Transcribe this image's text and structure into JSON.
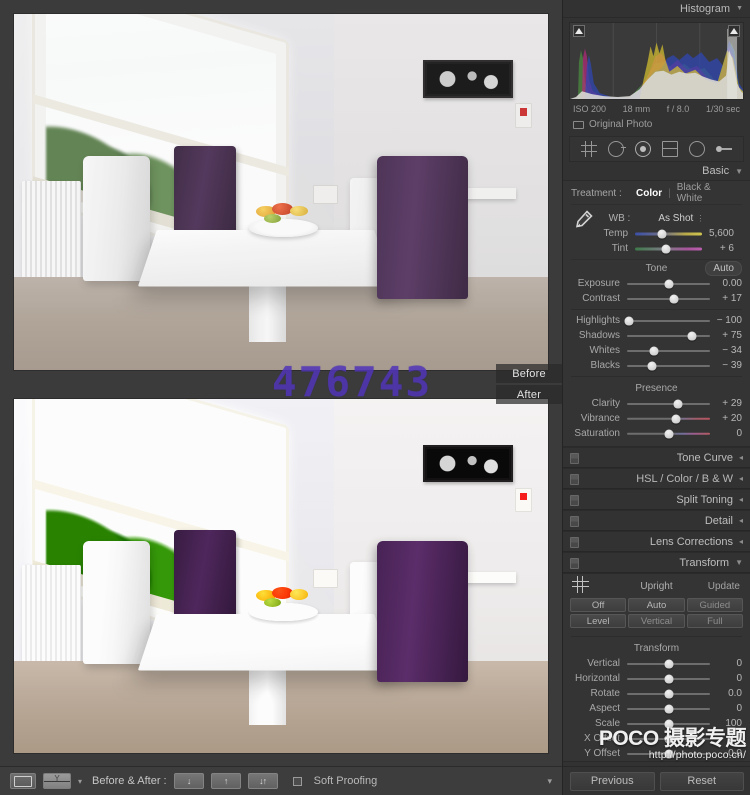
{
  "histogram": {
    "title": "Histogram",
    "iso": "ISO 200",
    "focal": "18 mm",
    "aperture": "f / 8.0",
    "shutter": "1/30 sec",
    "original_photo_label": "Original Photo",
    "clip_shadow_icon": "shadow-clipping-icon",
    "clip_highlight_icon": "highlight-clipping-icon"
  },
  "tools": [
    {
      "name": "crop-overlay-tool",
      "icon": "crop-icon"
    },
    {
      "name": "spot-removal-tool",
      "icon": "spot-removal-icon"
    },
    {
      "name": "red-eye-correction-tool",
      "icon": "red-eye-icon"
    },
    {
      "name": "graduated-filter-tool",
      "icon": "graduated-filter-icon"
    },
    {
      "name": "radial-filter-tool",
      "icon": "radial-filter-icon"
    },
    {
      "name": "adjustment-brush-tool",
      "icon": "brush-icon"
    }
  ],
  "basic": {
    "title": "Basic",
    "treatment_label": "Treatment :",
    "treatment_options": [
      "Color",
      "Black & White"
    ],
    "treatment_selected": "Color",
    "wb_label": "WB :",
    "wb_value": "As Shot",
    "wb_sliders": [
      {
        "name": "Temp",
        "value": "5,600",
        "pos": 40,
        "style": "temp"
      },
      {
        "name": "Tint",
        "value": "+ 6",
        "pos": 46,
        "style": "tint"
      }
    ],
    "tone_label": "Tone",
    "auto_label": "Auto",
    "tone_sliders": [
      {
        "name": "Exposure",
        "value": "0.00",
        "pos": 50,
        "style": "plain"
      },
      {
        "name": "Contrast",
        "value": "+ 17",
        "pos": 57,
        "style": "plain"
      }
    ],
    "tone_sliders2": [
      {
        "name": "Highlights",
        "value": "− 100",
        "pos": 3,
        "style": "plain"
      },
      {
        "name": "Shadows",
        "value": "+ 75",
        "pos": 78,
        "style": "plain"
      },
      {
        "name": "Whites",
        "value": "− 34",
        "pos": 33,
        "style": "plain"
      },
      {
        "name": "Blacks",
        "value": "− 39",
        "pos": 30,
        "style": "plain"
      }
    ],
    "presence_label": "Presence",
    "presence_sliders": [
      {
        "name": "Clarity",
        "value": "+ 29",
        "pos": 62,
        "style": "plain"
      },
      {
        "name": "Vibrance",
        "value": "+ 20",
        "pos": 59,
        "style": "vib"
      },
      {
        "name": "Saturation",
        "value": "0",
        "pos": 50,
        "style": "sat"
      }
    ]
  },
  "collapsed_sections": [
    {
      "title": "Tone Curve",
      "name": "tone-curve-panel"
    },
    {
      "title": "HSL / Color / B & W",
      "name": "hsl-color-bw-panel"
    },
    {
      "title": "Split Toning",
      "name": "split-toning-panel"
    },
    {
      "title": "Detail",
      "name": "detail-panel"
    },
    {
      "title": "Lens Corrections",
      "name": "lens-corrections-panel"
    }
  ],
  "transform": {
    "title": "Transform",
    "upright_label": "Upright",
    "update_label": "Update",
    "upright_buttons": [
      "Off",
      "Auto",
      "Guided",
      "Level",
      "Vertical",
      "Full"
    ],
    "transform_label": "Transform",
    "sliders": [
      {
        "name": "Vertical",
        "value": "0",
        "pos": 50
      },
      {
        "name": "Horizontal",
        "value": "0",
        "pos": 50
      },
      {
        "name": "Rotate",
        "value": "0.0",
        "pos": 50
      },
      {
        "name": "Aspect",
        "value": "0",
        "pos": 50
      },
      {
        "name": "Scale",
        "value": "100",
        "pos": 50
      },
      {
        "name": "X Offset",
        "value": "0.0",
        "pos": 50
      },
      {
        "name": "Y Offset",
        "value": "0.0",
        "pos": 50
      }
    ]
  },
  "footer": {
    "previous_label": "Previous",
    "reset_label": "Reset"
  },
  "toolbar": {
    "loupe_icon": "loupe-view-icon",
    "compare_icon": "before-after-view-icon",
    "dropdown_icon": "chevron-down-icon",
    "before_after_label": "Before & After :",
    "mode_buttons": [
      "↓",
      "↑",
      "↓↑"
    ],
    "soft_proofing_label": "Soft Proofing",
    "panel_toggle_icon": "chevron-down-icon"
  },
  "image_area": {
    "before_label": "Before",
    "after_label": "After",
    "watermark_number": "476743"
  },
  "watermark": {
    "brand": "POCO 摄影专题",
    "url": "http://photo.poco.cn/"
  },
  "colors": {
    "panel_bg": "#323232",
    "canvas_bg": "#3b3b3b",
    "text": "#b4b4b4",
    "watermark_purple": "#5538be"
  }
}
